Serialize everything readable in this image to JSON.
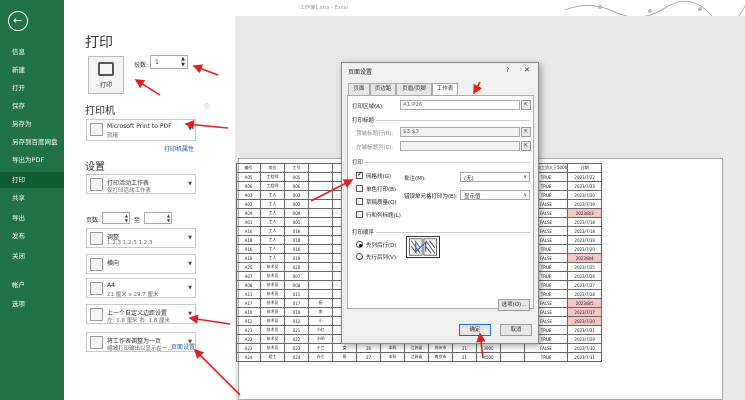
{
  "window": {
    "title": "工作簿1.xlsx - Excel"
  },
  "sidebar": {
    "back_icon": "arrow-left-icon",
    "items": [
      {
        "label": "信息"
      },
      {
        "label": "新建"
      },
      {
        "label": "打开"
      },
      {
        "label": "保存"
      },
      {
        "label": "另存为"
      },
      {
        "label": "另存到百度网盘"
      },
      {
        "label": "导出为PDF"
      },
      {
        "label": "打印",
        "active": true
      },
      {
        "label": "共享"
      },
      {
        "label": "导出"
      },
      {
        "label": "发布"
      },
      {
        "label": "关闭"
      },
      {
        "label": "帐户"
      },
      {
        "label": "选项"
      }
    ]
  },
  "print": {
    "heading": "打印",
    "print_button": "打印",
    "copies_label": "份数:",
    "copies_value": "1",
    "printer_heading": "打印机",
    "printer_name": "Microsoft Print to PDF",
    "printer_status": "就绪",
    "printer_props_link": "打印机属性",
    "settings_heading": "设置",
    "settings": [
      {
        "line1": "打印活动工作表",
        "line2": "仅打印活动工作表"
      },
      {
        "line1": "调整",
        "line2": "1,2,3   1,2,3   1,2,3"
      },
      {
        "line1": "横向",
        "line2": ""
      },
      {
        "line1": "A4",
        "line2": "21 厘米 x 29.7 厘米"
      },
      {
        "line1": "上一个自定义边距设置",
        "line2": "左: 1.8 厘米  右: 1.8 厘米"
      },
      {
        "line1": "将工作表调整为一页",
        "line2": "缩减打印输出以显示在一..."
      }
    ],
    "pages_label": "页数:",
    "to_label": "至",
    "page_setup_link": "页面设置"
  },
  "dialog": {
    "title": "页面设置",
    "help": "?",
    "close": "✕",
    "tabs": [
      "页面",
      "页边距",
      "页眉/页脚",
      "工作表"
    ],
    "active_tab": 3,
    "print_area_label": "打印区域(A):",
    "print_area_value": "A1:P26",
    "print_titles_label": "打印标题",
    "top_rows_label": "顶端标题行(R):",
    "top_rows_value": "$3:$3",
    "left_cols_label": "左端标题列(C):",
    "print_label": "打印",
    "gridlines": "网格线(G)",
    "bw": "单色打印(B)",
    "draft": "草稿质量(Q)",
    "headings": "行和列标题(L)",
    "comments_label": "批注(M):",
    "comments_value": "(无)",
    "errors_label": "错误单元格打印为(E):",
    "errors_value": "显示值",
    "order_label": "打印顺序",
    "order_down": "先列后行(D)",
    "order_over": "先行后列(V)",
    "options_button": "选项(O)...",
    "ok_button": "确定",
    "cancel_button": "取消"
  },
  "preview": {
    "rows": [
      [
        "编号",
        "岗位",
        "工号",
        "",
        "",
        "",
        "",
        "",
        "",
        "出勤天数",
        "奖金",
        "实发工资",
        "部门平均工资大于5000",
        "日期"
      ],
      [
        "A05",
        "工程师",
        "005",
        "",
        "",
        "",
        "",
        "",
        "",
        "22",
        "6200",
        "",
        "TRUE",
        "2023/7/22"
      ],
      [
        "A06",
        "工程师",
        "006",
        "",
        "",
        "",
        "",
        "",
        "",
        "21",
        "5200",
        "",
        "TRUE",
        "2023/7/23"
      ],
      [
        "A03",
        "工人",
        "003",
        "",
        "",
        "",
        "",
        "",
        "",
        "22",
        "4200",
        "",
        "TRUE",
        "2023/7/20"
      ],
      [
        "A02",
        "工人",
        "002",
        "",
        "",
        "",
        "",
        "",
        "",
        "21",
        "3900",
        "",
        "FALSE",
        "2023/7/19"
      ],
      [
        "A09",
        "工人",
        "009",
        "",
        "",
        "",
        "",
        "",
        "",
        "21",
        "3900",
        "",
        "FALSE",
        "2023/8/3"
      ],
      [
        "A01",
        "工人",
        "001",
        "",
        "",
        "",
        "",
        "",
        "",
        "21",
        "3900",
        "",
        "FALSE",
        "2023/7/18"
      ],
      [
        "A16",
        "工人",
        "016",
        "",
        "",
        "",
        "",
        "",
        "",
        "21",
        "3900",
        "",
        "FALSE",
        "2023/7/18"
      ],
      [
        "A18",
        "工人",
        "018",
        "",
        "",
        "",
        "",
        "",
        "",
        "21",
        "3900",
        "",
        "FALSE",
        "2023/7/19"
      ],
      [
        "A16",
        "工人",
        "016",
        "",
        "",
        "",
        "",
        "",
        "",
        "21",
        "4200",
        "",
        "TRUE",
        "2023/7/20"
      ],
      [
        "A19",
        "工人",
        "019",
        "",
        "",
        "",
        "",
        "",
        "",
        "21",
        "3900",
        "",
        "FALSE",
        "2023/8/4"
      ],
      [
        "A20",
        "技术员",
        "020",
        "",
        "",
        "",
        "",
        "",
        "",
        "21",
        "4500",
        "",
        "TRUE",
        "2023/7/25"
      ],
      [
        "A07",
        "技术员",
        "007",
        "",
        "",
        "",
        "",
        "",
        "",
        "21",
        "4500",
        "",
        "TRUE",
        "2023/7/26"
      ],
      [
        "A08",
        "技术员",
        "008",
        "",
        "",
        "",
        "",
        "",
        "",
        "21",
        "4500",
        "",
        "TRUE",
        "2023/7/27"
      ],
      [
        "A11",
        "技术员",
        "011",
        "",
        "",
        "",
        "",
        "",
        "",
        "21",
        "4500",
        "",
        "TRUE",
        "2023/7/28"
      ],
      [
        "A17",
        "技术员",
        "017",
        "杨",
        "",
        "",
        "",
        "",
        "",
        "21",
        "4500",
        "",
        "FALSE",
        "2023/8/5"
      ],
      [
        "A10",
        "技术员",
        "010",
        "李",
        "",
        "",
        "",
        "",
        "",
        "21",
        "4500",
        "",
        "FALSE",
        "2023/7/17"
      ],
      [
        "A12",
        "技术员",
        "012",
        "小",
        "",
        "",
        "",
        "",
        "",
        "21",
        "3900",
        "",
        "FALSE",
        "2023/7/20"
      ],
      [
        "A21",
        "技术员",
        "021",
        "小红",
        "男",
        "28",
        "专科",
        "江苏省",
        "南京市",
        "21",
        "4500",
        "",
        "TRUE",
        "2023/7/21"
      ],
      [
        "A22",
        "技术员",
        "022",
        "小明",
        "男",
        "27",
        "本科",
        "江苏省",
        "南京市",
        "21",
        "4500",
        "",
        "TRUE",
        "2023/7/29"
      ],
      [
        "A23",
        "技术员",
        "023",
        "小兰",
        "女",
        "26",
        "本科",
        "江苏省",
        "苏州市",
        "21",
        "3900",
        "",
        "FALSE",
        "2023/7/30"
      ],
      [
        "A24",
        "助工",
        "024",
        "许七",
        "男",
        "27",
        "本科",
        "江苏省",
        "南京市",
        "21",
        "4500",
        "",
        "TRUE",
        "2023/7/31"
      ]
    ],
    "pink_rows": [
      5,
      10,
      15,
      16,
      17
    ]
  },
  "colors": {
    "accent": "#217346",
    "active_nav": "#0e5c2f",
    "arrow": "#e02020",
    "link": "#1f5fa8"
  }
}
